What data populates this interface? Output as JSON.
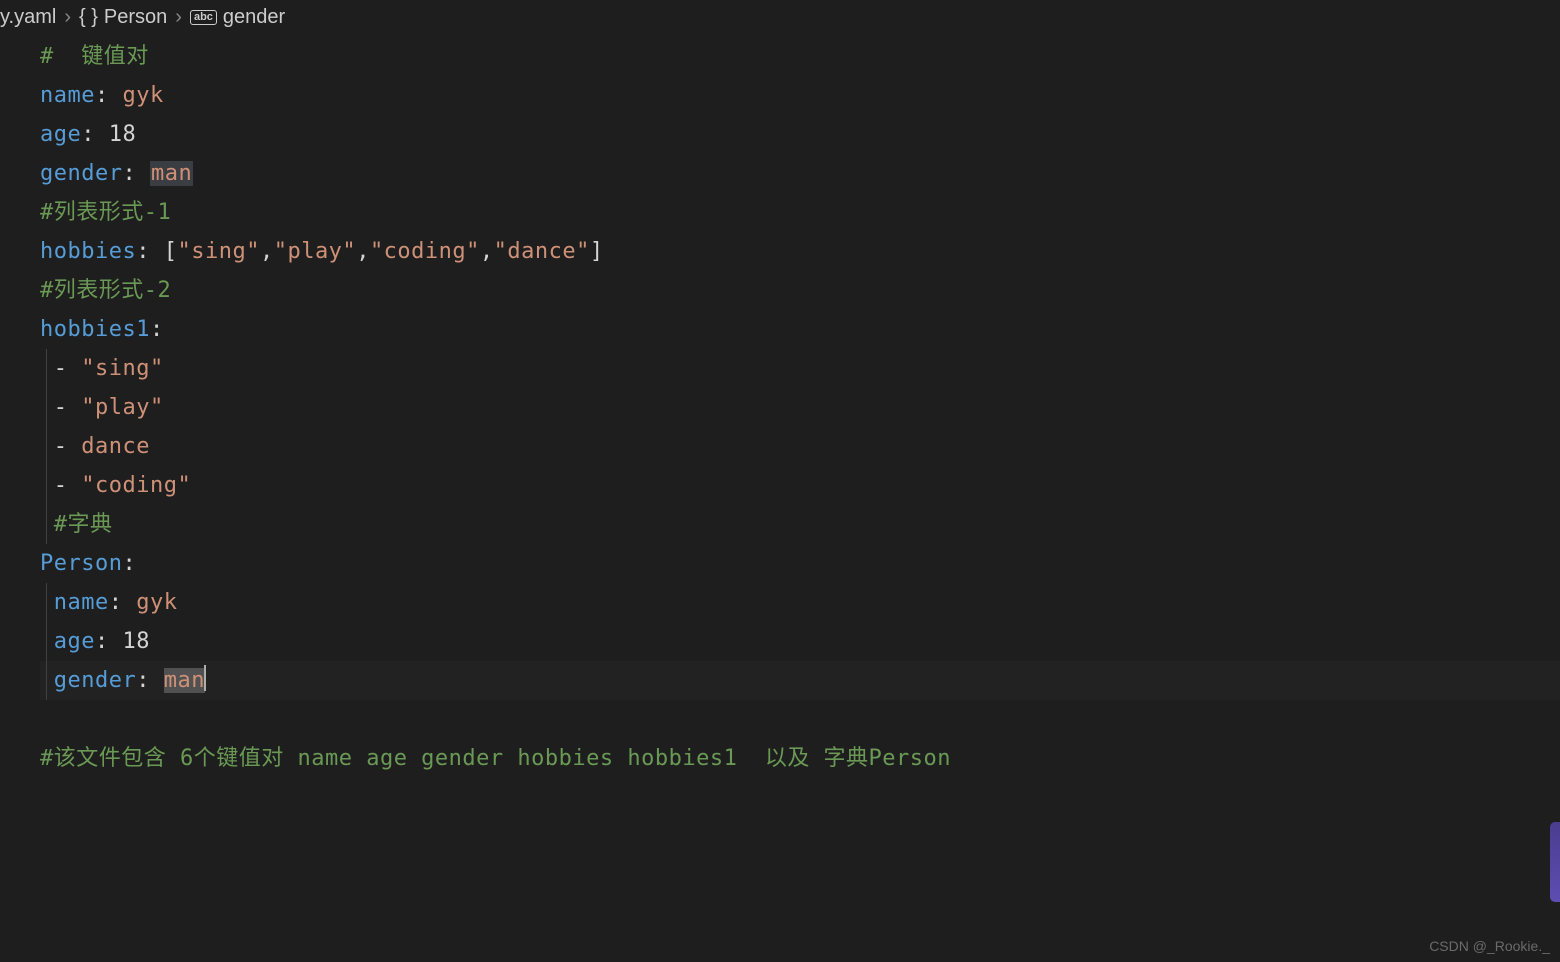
{
  "breadcrumb": {
    "file": "y.yaml",
    "segments": [
      {
        "icon": "braces",
        "label": "Person"
      },
      {
        "icon": "abc",
        "label": "gender"
      }
    ]
  },
  "code": {
    "l1_comment": "#  键值对",
    "l2_key": "name",
    "l2_val": "gyk",
    "l3_key": "age",
    "l3_val": "18",
    "l4_key": "gender",
    "l4_val": "man",
    "l5_comment": "#列表形式-1",
    "l6_key": "hobbies",
    "l6_arr_open": "[",
    "l6_s1": "\"sing\"",
    "l6_c1": ",",
    "l6_s2": "\"play\"",
    "l6_c2": ",",
    "l6_s3": "\"coding\"",
    "l6_c3": ",",
    "l6_s4": "\"dance\"",
    "l6_arr_close": "]",
    "l7_comment": "#列表形式-2",
    "l8_key": "hobbies1",
    "l9_item": "\"sing\"",
    "l10_item": "\"play\"",
    "l11_item": "dance",
    "l12_item": "\"coding\"",
    "l13_comment": "#字典",
    "l14_key": "Person",
    "l15_key": "name",
    "l15_val": "gyk",
    "l16_key": "age",
    "l16_val": "18",
    "l17_key": "gender",
    "l17_val": "man",
    "l19_comment": "#该文件包含 6个键值对 name age gender hobbies hobbies1  以及 字典Person"
  },
  "watermark": "CSDN @_Rookie._"
}
